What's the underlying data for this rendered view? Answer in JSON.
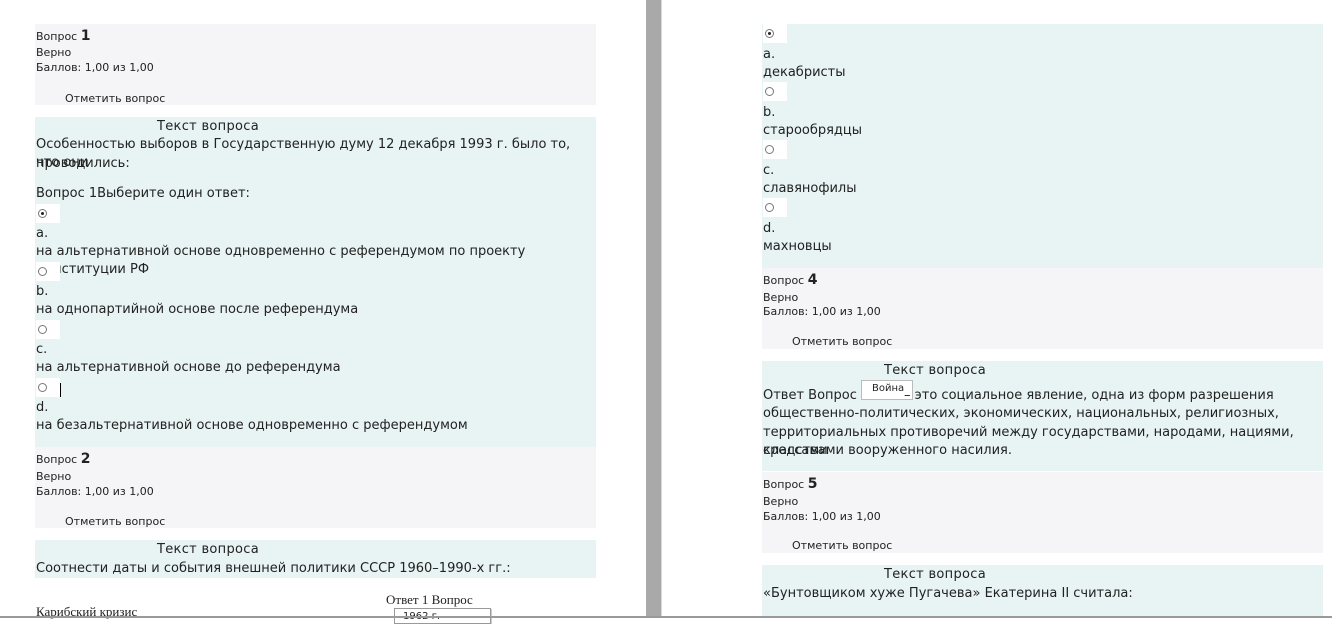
{
  "left": {
    "q1": {
      "label": "Вопрос",
      "number": "1",
      "status": "Верно",
      "score": "Баллов: 1,00 из 1,00",
      "flag": "Отметить вопрос",
      "heading": "Текст вопроса",
      "text_line1": "Особенностью выборов в Государственную думу 12 декабря 1993 г. было то, что они",
      "text_line2": "проводились:",
      "prompt": "Вопрос 1Выберите один ответ:",
      "options": [
        {
          "letter": "a.",
          "text": "на альтернативной основе одновременно с референдумом по проекту Конституции РФ",
          "selected": true
        },
        {
          "letter": "b.",
          "text": "на однопартийной основе после референдума",
          "selected": false
        },
        {
          "letter": "c.",
          "text": "на альтернативной основе до референдума",
          "selected": false
        },
        {
          "letter": "d.",
          "text": "на безальтернативной основе одновременно с референдумом",
          "selected": false
        }
      ]
    },
    "q2": {
      "label": "Вопрос",
      "number": "2",
      "status": "Верно",
      "score": "Баллов: 1,00 из 1,00",
      "flag": "Отметить вопрос",
      "heading": "Текст вопроса",
      "text": "Соотнести даты и события внешней политики СССР 1960–1990-х гг.:",
      "answer_header": "Ответ 1 Вопрос",
      "row1_label": "Карибский кризис",
      "row1_select": "1962 г."
    }
  },
  "right": {
    "q3": {
      "options": [
        {
          "letter": "a.",
          "text": "декабристы",
          "selected": true
        },
        {
          "letter": "b.",
          "text": "старообрядцы",
          "selected": false
        },
        {
          "letter": "c.",
          "text": "славянофилы",
          "selected": false
        },
        {
          "letter": "d.",
          "text": "махновцы",
          "selected": false
        }
      ]
    },
    "q4": {
      "label": "Вопрос",
      "number": "4",
      "status": "Верно",
      "score": "Баллов: 1,00 из 1,00",
      "flag": "Отметить вопрос",
      "heading": "Текст вопроса",
      "answer_prefix": "Ответ Вопрос 4",
      "input_value": "Война",
      "text_line1": "– это социальное явление, одна из форм разрешения",
      "text_line2": "общественно-политических, экономических, национальных, религиозных,",
      "text_line3": "территориальных противоречий между государствами, народами, нациями, классами",
      "text_line4": "средствами вооруженного насилия."
    },
    "q5": {
      "label": "Вопрос",
      "number": "5",
      "status": "Верно",
      "score": "Баллов: 1,00 из 1,00",
      "flag": "Отметить вопрос",
      "heading": "Текст вопроса",
      "text": "«Бунтовщиком хуже Пугачева» Екатерина II считала:"
    }
  }
}
